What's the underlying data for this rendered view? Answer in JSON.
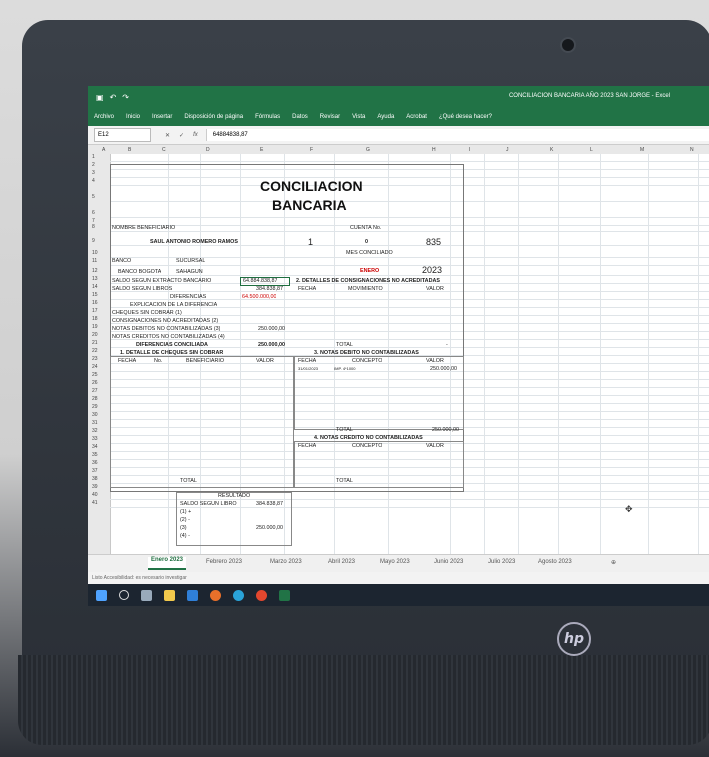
{
  "window": {
    "title": "CONCILIACION BANCARIA AÑO 2023 SAN JORGE  -  Excel",
    "ribbon_tabs": [
      "Archivo",
      "Inicio",
      "Insertar",
      "Disposición de página",
      "Fórmulas",
      "Datos",
      "Revisar",
      "Vista",
      "Ayuda",
      "Acrobat",
      "¿Qué desea hacer?"
    ]
  },
  "formula_bar": {
    "name_box": "E12",
    "fx": "fx",
    "value": "64884838,87"
  },
  "columns": [
    "A",
    "B",
    "C",
    "D",
    "E",
    "F",
    "G",
    "H",
    "I",
    "J",
    "K",
    "L",
    "M",
    "N"
  ],
  "rows": [
    "1",
    "2",
    "3",
    "4",
    "5",
    "6",
    "7",
    "8",
    "9",
    "10",
    "11",
    "12",
    "13",
    "14",
    "15",
    "16",
    "17",
    "18",
    "19",
    "20",
    "21",
    "22",
    "23",
    "24",
    "25",
    "26",
    "27",
    "28",
    "29",
    "30",
    "31",
    "32",
    "33",
    "34",
    "35",
    "36",
    "37",
    "38",
    "39",
    "40",
    "41"
  ],
  "sheet": {
    "title_line1": "CONCILIACION",
    "title_line2": "BANCARIA",
    "nombre_beneficiario_label": "NOMBRE BENEFICIARIO",
    "beneficiario": "SAUL ANTONIO ROMERO RAMOS",
    "cuenta_label": "CUENTA No.",
    "cuenta_num1": "1",
    "cuenta_num2": "0",
    "cuenta_num3": "835",
    "mes_label": "MES CONCILIADO",
    "banco_label": "BANCO",
    "sucursal_label": "SUCURSAL",
    "banco_value": "BANCO BOGOTA",
    "sucursal_value": "SAHAGUN",
    "mes_value": "ENERO",
    "anio": "2023",
    "saldo_extracto_label": "SALDO SEGUN EXTRACTO BANCARIO",
    "saldo_extracto_value": "64.884.838,87",
    "saldo_libros_label": "SALDO SEGUN LIBROS",
    "saldo_libros_value": "384.838,87",
    "diferencias_label": "DIFERENCIAS",
    "diferencias_value": "64.500.000,00",
    "explicacion_label": "EXPLICACION DE LA DIFERENCIA",
    "cheques_label": "CHEQUES SIN COBRAR (1)",
    "consignaciones_label": "CONSIGNACIONES NO ACREDITADAS (2)",
    "notas_debito_label": "NOTAS DEBITOS NO CONTABILIZADAS (3)",
    "notas_debito_value": "250.000,00",
    "notas_credito_label": "NOTAS CREDITOS NO CONTABILIZADAS (4)",
    "dif_conciliada_label": "DIFERENCIAS CONCILIADA",
    "dif_conciliada_value": "250.000,00",
    "sec2_title": "2. DETALLES DE CONSIGNACIONES NO ACREDITADAS",
    "sec2_headers": [
      "FECHA",
      "MOVIMIENTO",
      "VALOR"
    ],
    "total_label": "TOTAL",
    "total2_value": "-",
    "sec1_title": "1. DETALLE DE CHEQUES SIN COBRAR",
    "sec1_headers": [
      "FECHA",
      "No.",
      "BENEFICIARIO",
      "VALOR"
    ],
    "sec3_title": "3. NOTAS DEBITO NO CONTABILIZADAS",
    "sec3_headers": [
      "FECHA",
      "CONCEPTO",
      "VALOR"
    ],
    "sec3_row": {
      "fecha": "31/01/2023",
      "concepto": "IMP. 4*1000",
      "valor": "250.000,00"
    },
    "total3_value": "250.000,00",
    "sec4_title": "4. NOTAS CREDITO NO CONTABILIZADAS",
    "sec4_headers": [
      "FECHA",
      "CONCEPTO",
      "VALOR"
    ],
    "total1_label": "TOTAL",
    "total4_label": "TOTAL",
    "resultado_label": "RESULTADO",
    "res_saldo_label": "SALDO SEGUN LIBRO",
    "res_saldo_value": "384.838,87",
    "res_1": "(1) +",
    "res_2": "(2) -",
    "res_3": "(3)",
    "res_3_value": "250.000,00",
    "res_4": "(4) -"
  },
  "sheet_tabs": [
    "Enero 2023",
    "Febrero 2023",
    "Marzo 2023",
    "Abril 2023",
    "Mayo 2023",
    "Junio 2023",
    "Julio 2023",
    "Agosto 2023"
  ],
  "status": "Listo    Accesibilidad: es necesario investigar",
  "brand_logo": "hp",
  "colors": {
    "excel_green": "#217346",
    "red": "#cc0000"
  }
}
